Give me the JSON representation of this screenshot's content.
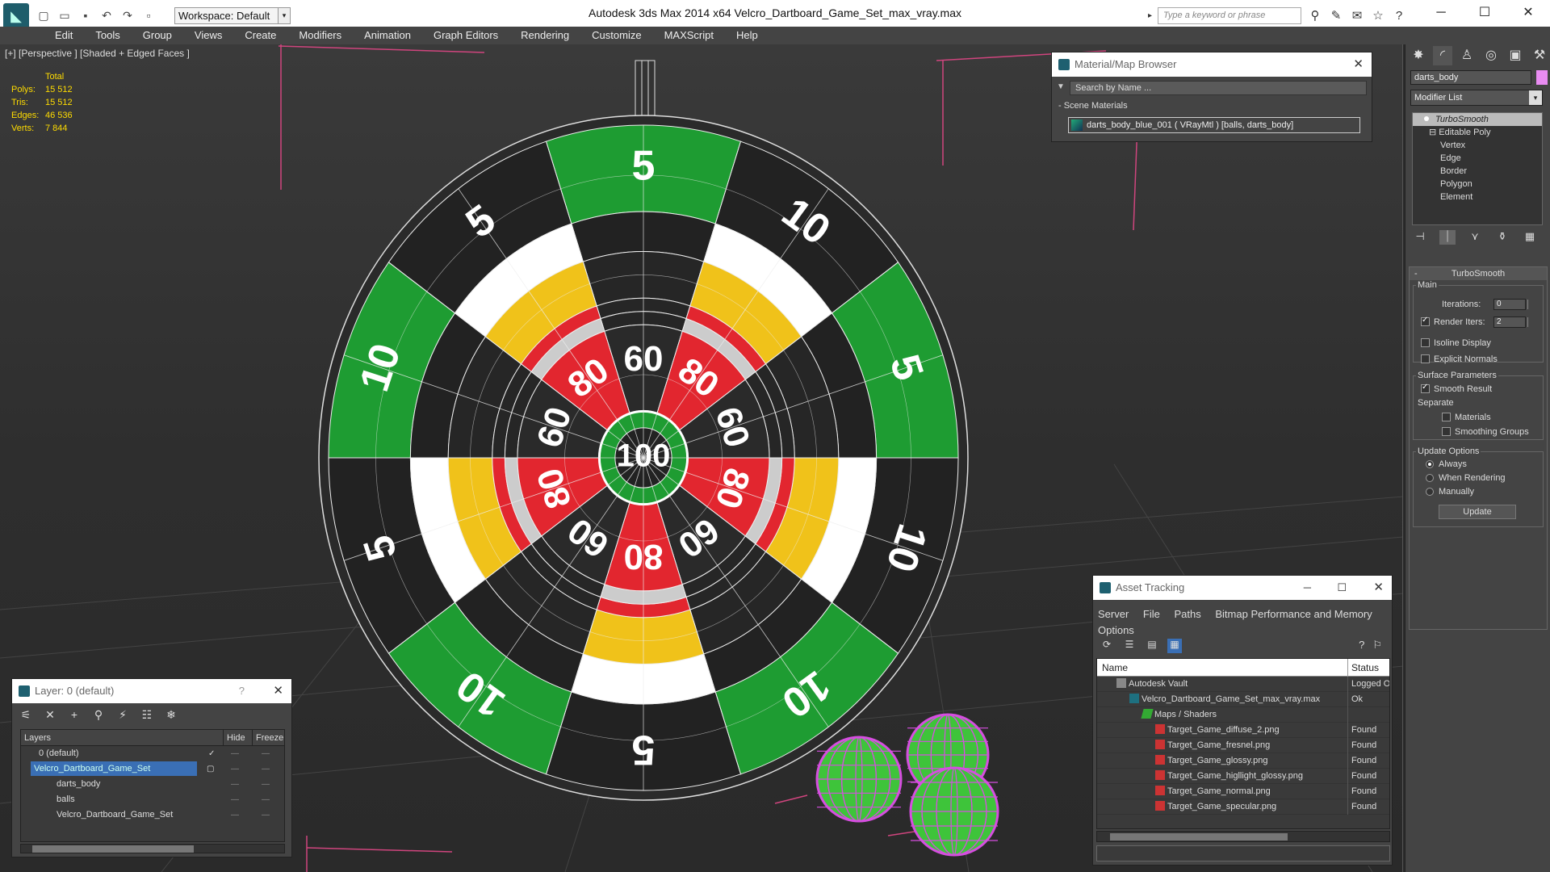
{
  "titlebar": {
    "workspace": "Workspace: Default",
    "title": "Autodesk 3ds Max  2014 x64      Velcro_Dartboard_Game_Set_max_vray.max",
    "search_placeholder": "Type a keyword or phrase"
  },
  "menu": [
    "Edit",
    "Tools",
    "Group",
    "Views",
    "Create",
    "Modifiers",
    "Animation",
    "Graph Editors",
    "Rendering",
    "Customize",
    "MAXScript",
    "Help"
  ],
  "viewport": {
    "label": "[+] [Perspective ] [Shaded + Edged Faces ]",
    "stats": {
      "header": "Total",
      "rows": [
        {
          "k": "Polys:",
          "v": "15 512"
        },
        {
          "k": "Tris:",
          "v": "15 512"
        },
        {
          "k": "Edges:",
          "v": "46 536"
        },
        {
          "k": "Verts:",
          "v": "7 844"
        }
      ]
    },
    "board": {
      "outer_numbers": [
        "5",
        "10",
        "5",
        "10",
        "10",
        "5",
        "10",
        "5",
        "10",
        "5"
      ],
      "inner_numbers": [
        "60",
        "80",
        "60",
        "80",
        "60",
        "80",
        "60",
        "80",
        "60",
        "80"
      ],
      "center": "100"
    }
  },
  "material_browser": {
    "title": "Material/Map Browser",
    "search_placeholder": "Search by Name ...",
    "section": "- Scene Materials",
    "item": "darts_body_blue_001 ( VRayMtl ) [balls, darts_body]"
  },
  "command_panel": {
    "object_name": "darts_body",
    "object_color": "#e98cf2",
    "modifier_list": "Modifier List",
    "stack": [
      "TurboSmooth",
      "Editable Poly",
      "Vertex",
      "Edge",
      "Border",
      "Polygon",
      "Element"
    ],
    "rollout_title": "TurboSmooth",
    "main_label": "Main",
    "iterations_label": "Iterations:",
    "iterations_value": "0",
    "render_iters_label": "Render Iters:",
    "render_iters_value": "2",
    "isoline": "Isoline Display",
    "explicit": "Explicit Normals",
    "surface_params": "Surface Parameters",
    "smooth_result": "Smooth Result",
    "separate": "Separate",
    "materials": "Materials",
    "smoothing_groups": "Smoothing Groups",
    "update_options": "Update Options",
    "always": "Always",
    "when_rendering": "When Rendering",
    "manually": "Manually",
    "update_button": "Update"
  },
  "layer_panel": {
    "title": "Layer: 0 (default)",
    "help": "?",
    "col_layers": "Layers",
    "col_hide": "Hide",
    "col_freeze": "Freeze",
    "rows": [
      "0 (default)",
      "Velcro_Dartboard_Game_Set",
      "darts_body",
      "balls",
      "Velcro_Dartboard_Game_Set"
    ]
  },
  "asset_tracking": {
    "title": "Asset Tracking",
    "menu": [
      "Server",
      "File",
      "Paths",
      "Bitmap Performance and Memory",
      "Options"
    ],
    "col_name": "Name",
    "col_status": "Status",
    "rows": [
      {
        "name": "Autodesk Vault",
        "status": "Logged Out"
      },
      {
        "name": "Velcro_Dartboard_Game_Set_max_vray.max",
        "status": "Ok"
      },
      {
        "name": "Maps / Shaders",
        "status": ""
      },
      {
        "name": "Target_Game_diffuse_2.png",
        "status": "Found"
      },
      {
        "name": "Target_Game_fresnel.png",
        "status": "Found"
      },
      {
        "name": "Target_Game_glossy.png",
        "status": "Found"
      },
      {
        "name": "Target_Game_higllight_glossy.png",
        "status": "Found"
      },
      {
        "name": "Target_Game_normal.png",
        "status": "Found"
      },
      {
        "name": "Target_Game_specular.png",
        "status": "Found"
      }
    ]
  }
}
